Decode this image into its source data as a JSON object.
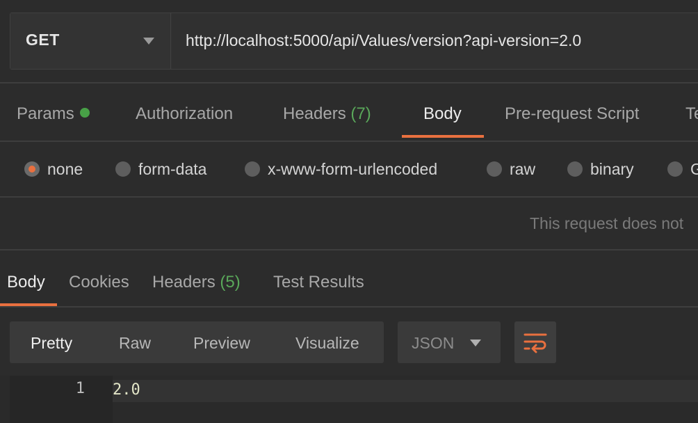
{
  "request": {
    "method": "GET",
    "url": "http://localhost:5000/api/Values/version?api-version=2.0"
  },
  "request_tabs": [
    {
      "label": "Params",
      "indicator": "green-dot"
    },
    {
      "label": "Authorization"
    },
    {
      "label": "Headers",
      "count": "(7)"
    },
    {
      "label": "Body",
      "active": true
    },
    {
      "label": "Pre-request Script"
    },
    {
      "label": "Te"
    }
  ],
  "body_types": [
    {
      "label": "none",
      "selected": true
    },
    {
      "label": "form-data"
    },
    {
      "label": "x-www-form-urlencoded"
    },
    {
      "label": "raw"
    },
    {
      "label": "binary"
    },
    {
      "label": "G"
    }
  ],
  "body_message": "This request does not",
  "response_tabs": [
    {
      "label": "Body",
      "active": true
    },
    {
      "label": "Cookies"
    },
    {
      "label": "Headers",
      "count": "(5)"
    },
    {
      "label": "Test Results"
    }
  ],
  "view_modes": [
    {
      "label": "Pretty",
      "active": true
    },
    {
      "label": "Raw"
    },
    {
      "label": "Preview"
    },
    {
      "label": "Visualize"
    }
  ],
  "format": "JSON",
  "response_lines": [
    {
      "number": "1",
      "text": "2.0"
    }
  ],
  "colors": {
    "accent": "#e9703f",
    "success": "#48a147",
    "background": "#2c2c2c"
  },
  "icons": {
    "method_dropdown": "chevron-down-icon",
    "format_dropdown": "chevron-down-icon",
    "wrap": "wrap-lines-icon"
  }
}
